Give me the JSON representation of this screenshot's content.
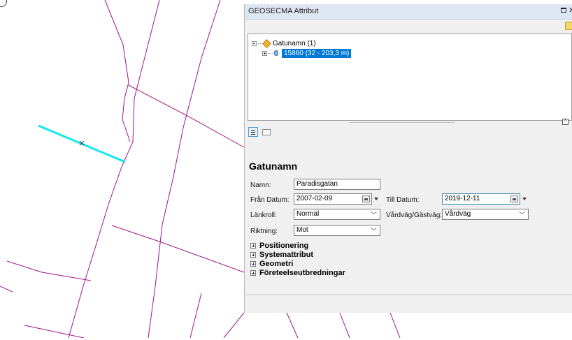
{
  "window": {
    "title": "GEOSECMA Attribut"
  },
  "tree": {
    "root_label": "Gatunamn (1)",
    "child_label": "15860 (32 - 203,3 m)"
  },
  "form": {
    "heading": "Gatunamn",
    "namn_label": "Namn:",
    "namn_value": "Paradisgatan",
    "fran_datum_label": "Från Datum:",
    "fran_datum_value": "2007-02-09",
    "till_datum_label": "Till Datum:",
    "till_datum_value": "2019-12-11",
    "lankroll_label": "Länkroll:",
    "lankroll_value": "Normal",
    "vardvag_label": "Vårdväg/Gästväg:",
    "vardvag_value": "Vårdväg",
    "riktning_label": "Riktning:",
    "riktning_value": "Mot"
  },
  "sections": [
    {
      "label": "Positionering"
    },
    {
      "label": "Systemattribut"
    },
    {
      "label": "Geometri"
    },
    {
      "label": "Företeelseutbredningar"
    }
  ],
  "map": {
    "road_color": "#a0148c",
    "highlight_color": "#19e6ef"
  },
  "icons": [
    "help-icon",
    "road-feature-icon",
    "database-icon",
    "attributes-tab-icon",
    "folder-tab-icon",
    "calendar-icon"
  ]
}
